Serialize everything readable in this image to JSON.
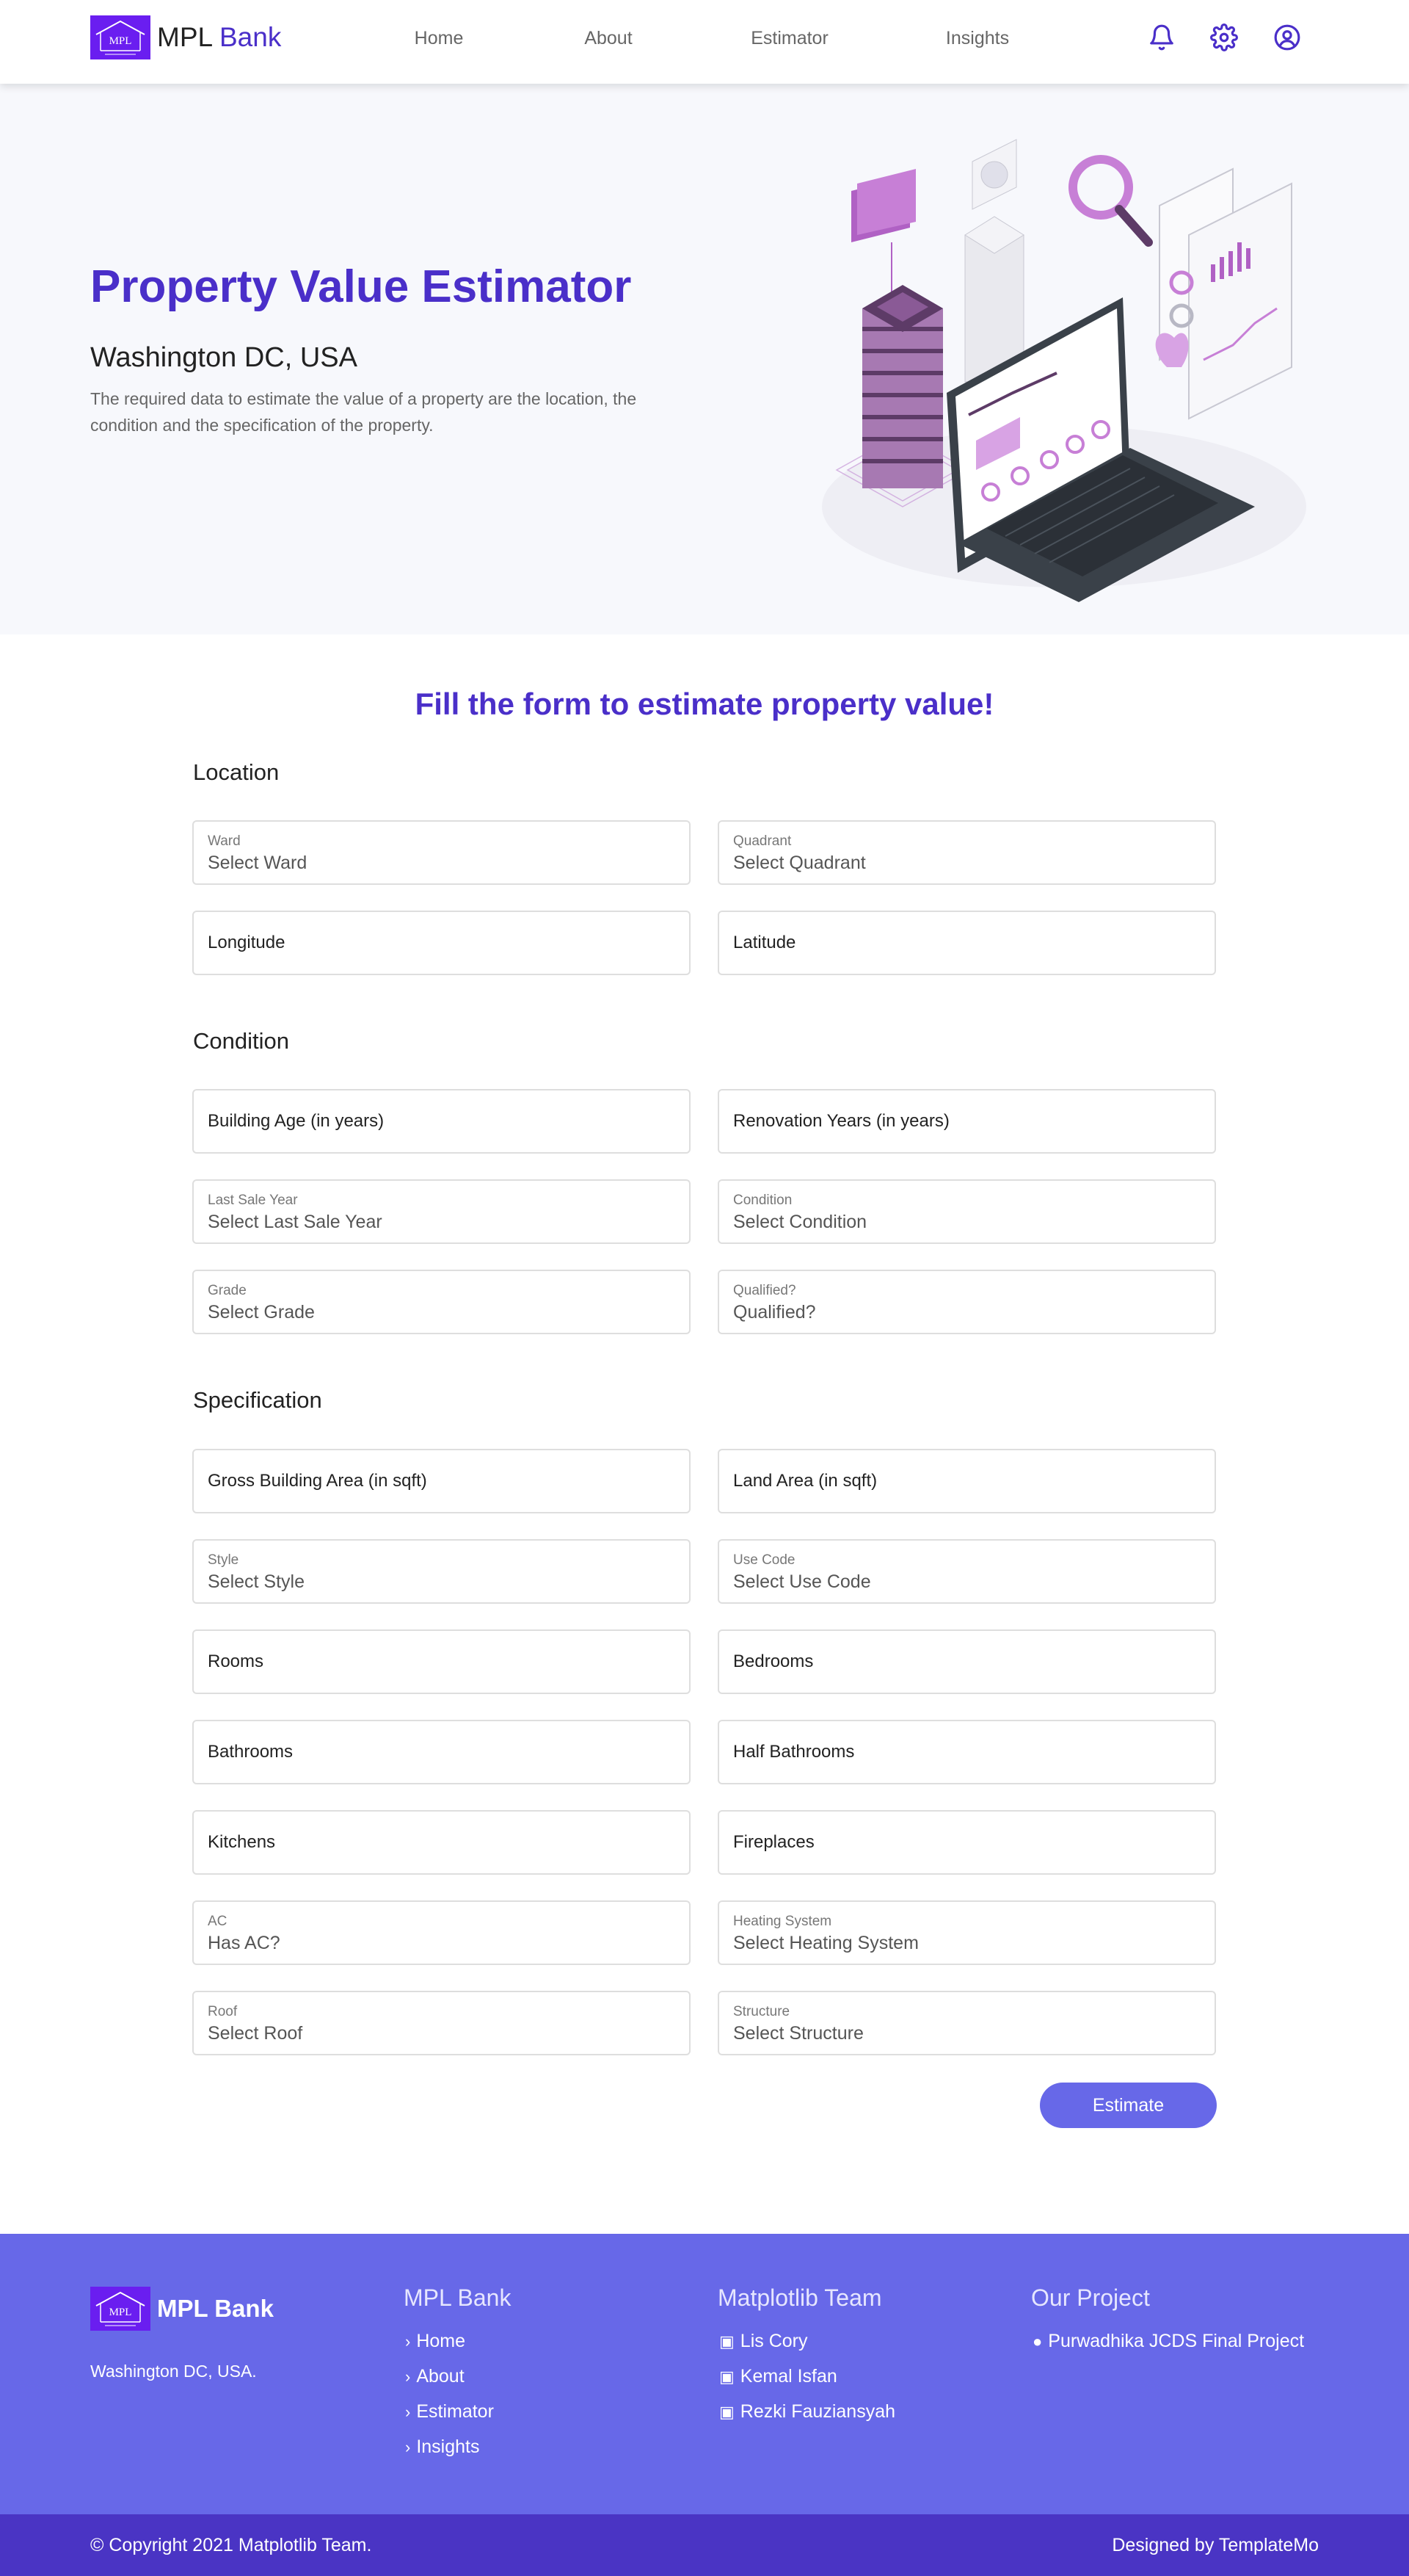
{
  "brand": {
    "logo_mark": "MPL",
    "name_part1": "MPL",
    "name_part2": "Bank",
    "accent_color": "#4a2fc9",
    "logo_color": "#6a1ef0"
  },
  "nav": {
    "items": [
      "Home",
      "About",
      "Estimator",
      "Insights"
    ]
  },
  "header_icons": [
    "bell-icon",
    "gear-icon",
    "user-circle-icon"
  ],
  "hero": {
    "title": "Property Value Estimator",
    "subtitle": "Washington DC, USA",
    "description": "The required data to estimate the value of a property are the location, the condition and the specification of the property."
  },
  "form": {
    "title": "Fill the form to estimate property value!",
    "sections": {
      "location": "Location",
      "condition": "Condition",
      "specification": "Specification"
    },
    "fields": {
      "ward": {
        "label": "Ward",
        "value": "Select Ward"
      },
      "quadrant": {
        "label": "Quadrant",
        "value": "Select Quadrant"
      },
      "longitude": {
        "placeholder": "Longitude"
      },
      "latitude": {
        "placeholder": "Latitude"
      },
      "building_age": {
        "placeholder": "Building Age (in years)"
      },
      "renovation_years": {
        "placeholder": "Renovation Years (in years)"
      },
      "last_sale_year": {
        "label": "Last Sale Year",
        "value": "Select Last Sale Year"
      },
      "condition": {
        "label": "Condition",
        "value": "Select Condition"
      },
      "grade": {
        "label": "Grade",
        "value": "Select Grade"
      },
      "qualified": {
        "label": "Qualified?",
        "value": "Qualified?"
      },
      "gross_building_area": {
        "placeholder": "Gross Building Area (in sqft)"
      },
      "land_area": {
        "placeholder": "Land Area (in sqft)"
      },
      "style": {
        "label": "Style",
        "value": "Select Style"
      },
      "use_code": {
        "label": "Use Code",
        "value": "Select Use Code"
      },
      "rooms": {
        "placeholder": "Rooms"
      },
      "bedrooms": {
        "placeholder": "Bedrooms"
      },
      "bathrooms": {
        "placeholder": "Bathrooms"
      },
      "half_bathrooms": {
        "placeholder": "Half Bathrooms"
      },
      "kitchens": {
        "placeholder": "Kitchens"
      },
      "fireplaces": {
        "placeholder": "Fireplaces"
      },
      "ac": {
        "label": "AC",
        "value": "Has AC?"
      },
      "heating_system": {
        "label": "Heating System",
        "value": "Select Heating System"
      },
      "roof": {
        "label": "Roof",
        "value": "Select Roof"
      },
      "structure": {
        "label": "Structure",
        "value": "Select Structure"
      }
    },
    "submit_label": "Estimate",
    "button_color": "#6768e8"
  },
  "footer": {
    "brand": "MPL Bank",
    "address": "Washington DC, USA.",
    "columns": [
      {
        "title": "MPL Bank",
        "icon": "chevron-right-icon",
        "items": [
          "Home",
          "About",
          "Estimator",
          "Insights"
        ]
      },
      {
        "title": "Matplotlib Team",
        "icon": "linkedin-icon",
        "items": [
          "Lis Cory",
          "Kemal Isfan",
          "Rezki Fauziansyah"
        ]
      },
      {
        "title": "Our Project",
        "icon": "github-icon",
        "items": [
          "Purwadhika JCDS Final Project"
        ]
      }
    ],
    "background": "#6768e8",
    "bottom_background": "#4a34c4",
    "copyright_prefix": "© Copyright 2021",
    "copyright_team": "Matplotlib Team",
    "copyright_suffix": ".",
    "designed_prefix": "Designed by",
    "designed_by": "TemplateMo"
  }
}
